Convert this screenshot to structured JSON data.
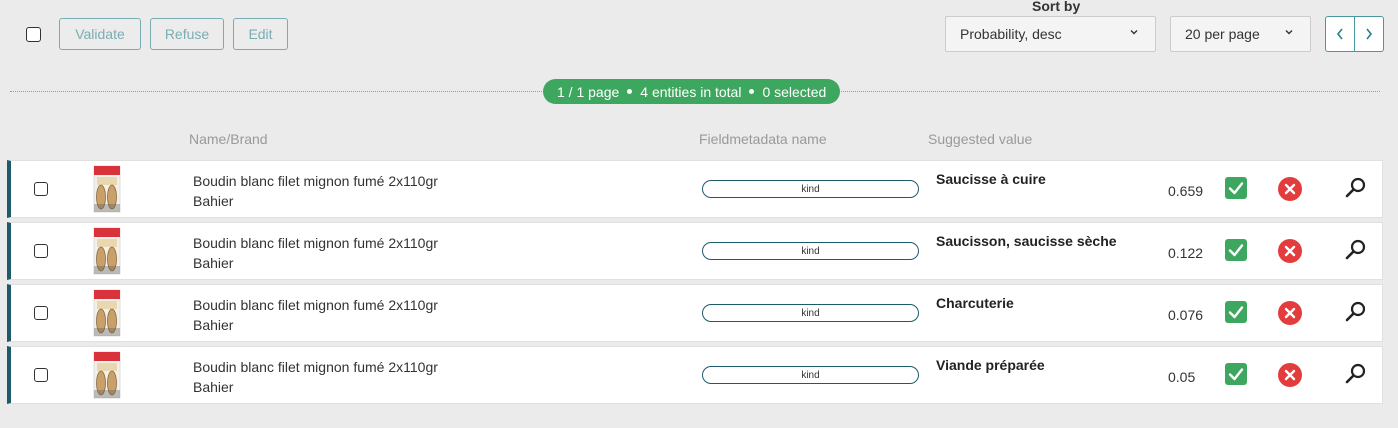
{
  "toolbar": {
    "validate_label": "Validate",
    "refuse_label": "Refuse",
    "edit_label": "Edit",
    "sort_by_label": "Sort by",
    "sort_value": "Probability, desc",
    "per_page_value": "20 per page"
  },
  "summary": {
    "pages": "1 / 1 page",
    "entities": "4 entities in total",
    "selected": "0 selected"
  },
  "columns": {
    "name_brand": "Name/Brand",
    "field_name": "Fieldmetadata name",
    "suggested": "Suggested value"
  },
  "rows": [
    {
      "name": "Boudin blanc filet mignon fumé 2x110gr",
      "brand": "Bahier",
      "field": "kind",
      "suggestion": "Saucisse à cuire",
      "probability": "0.659"
    },
    {
      "name": "Boudin blanc filet mignon fumé 2x110gr",
      "brand": "Bahier",
      "field": "kind",
      "suggestion": "Saucisson, saucisse sèche",
      "probability": "0.122"
    },
    {
      "name": "Boudin blanc filet mignon fumé 2x110gr",
      "brand": "Bahier",
      "field": "kind",
      "suggestion": "Charcuterie",
      "probability": "0.076"
    },
    {
      "name": "Boudin blanc filet mignon fumé 2x110gr",
      "brand": "Bahier",
      "field": "kind",
      "suggestion": "Viande préparée",
      "probability": "0.05"
    }
  ],
  "icons": {
    "dropdown": "chevron-down-icon",
    "prev": "chevron-left-icon",
    "next": "chevron-right-icon",
    "accept": "checkmark-icon",
    "reject": "close-circle-icon",
    "inspect": "search-icon"
  },
  "colors": {
    "accent": "#1e5b6a",
    "success": "#3ea75f",
    "danger": "#e23c3c",
    "button_outline": "#7aadb3"
  }
}
